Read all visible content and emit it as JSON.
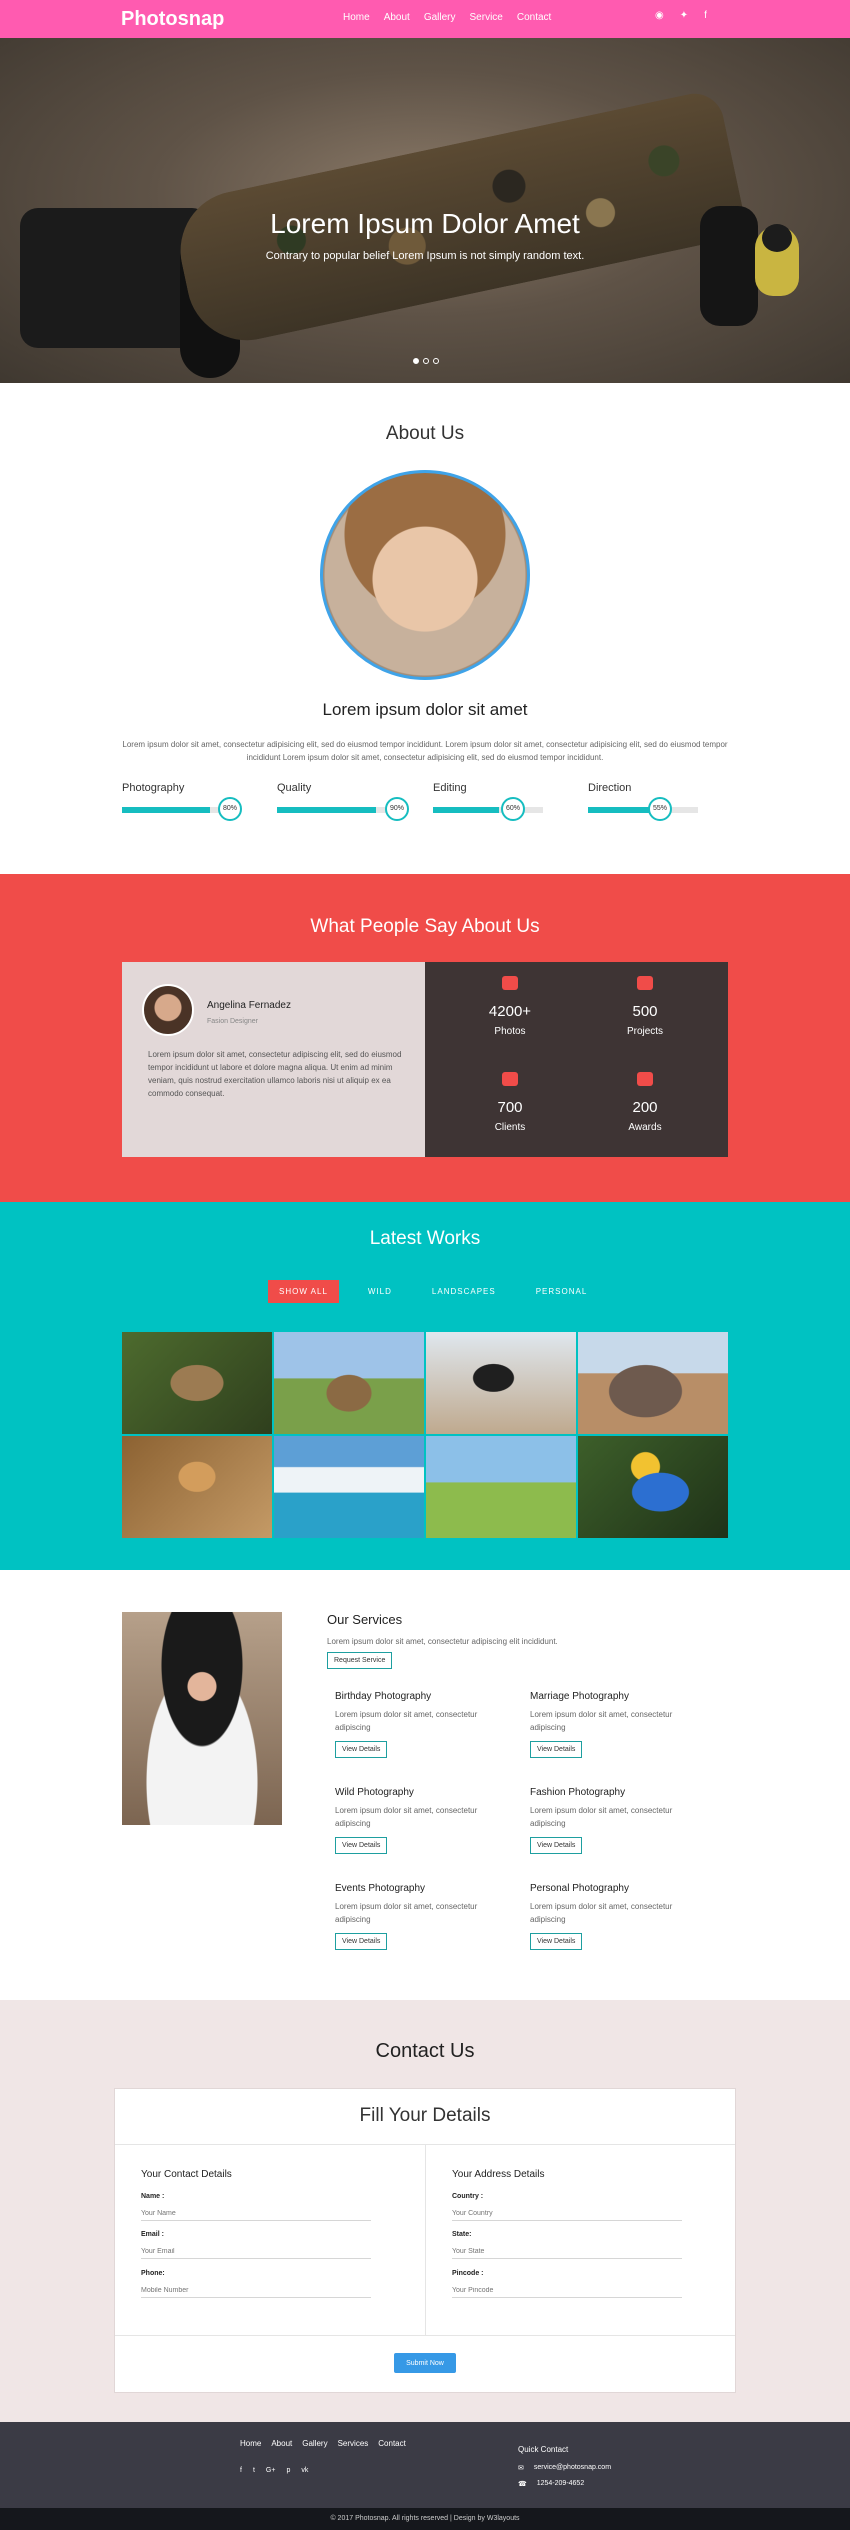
{
  "nav": {
    "brand": "Photosnap",
    "items": [
      "Home",
      "About",
      "Gallery",
      "Service",
      "Contact"
    ],
    "social_icons": [
      "rss-icon",
      "twitter-icon",
      "facebook-icon"
    ],
    "social_glyphs": [
      "ℜ",
      "🐦",
      "f"
    ]
  },
  "hero": {
    "title": "Lorem Ipsum Dolor Amet",
    "subtitle": "Contrary to popular belief Lorem Ipsum is not simply random text."
  },
  "about": {
    "title": "About Us",
    "heading": "Lorem ipsum dolor sit amet",
    "text": "Lorem ipsum dolor sit amet, consectetur adipisicing elit, sed do eiusmod tempor incididunt. Lorem ipsum dolor sit amet, consectetur adipisicing elit, sed do eiusmod tempor incididunt Lorem ipsum dolor sit amet, consectetur adipisicing elit, sed do eiusmod tempor incididunt.",
    "skills": [
      {
        "label": "Photography",
        "percent": 80,
        "display": "80%"
      },
      {
        "label": "Quality",
        "percent": 90,
        "display": "90%"
      },
      {
        "label": "Editing",
        "percent": 60,
        "display": "60%"
      },
      {
        "label": "Direction",
        "percent": 55,
        "display": "55%"
      }
    ]
  },
  "testimonial": {
    "title": "What People Say About Us",
    "name": "Angelina Fernadez",
    "role": "Fasion Designer",
    "quote": "Lorem ipsum dolor sit amet, consectetur adipiscing elit, sed do eiusmod tempor incididunt ut labore et dolore magna aliqua. Ut enim ad minim veniam, quis nostrud exercitation ullamco laboris nisi ut aliquip ex ea commodo consequat.",
    "stats": [
      {
        "value": "4200+",
        "label": "Photos",
        "icon": "camera-icon"
      },
      {
        "value": "500",
        "label": "Projects",
        "icon": "rocket-icon"
      },
      {
        "value": "700",
        "label": "Clients",
        "icon": "users-icon"
      },
      {
        "value": "200",
        "label": "Awards",
        "icon": "handshake-icon"
      }
    ]
  },
  "works": {
    "title": "Latest Works",
    "filters": [
      "SHOW ALL",
      "WILD",
      "LANDSCAPES",
      "PERSONAL"
    ],
    "active_filter": "SHOW ALL",
    "images": [
      "owl",
      "deer",
      "woman-with-camera",
      "elephants",
      "butterfly",
      "glacier",
      "countryside-road",
      "parrot"
    ]
  },
  "services": {
    "title": "Our Services",
    "desc": "Lorem ipsum dolor sit amet, consectetur adipiscing elit incididunt.",
    "request_label": "Request Service",
    "item_text": "Lorem ipsum dolor sit amet, consectetur adipiscing",
    "details_label": "View Details",
    "items": [
      "Birthday Photography",
      "Marriage Photography",
      "Wild Photography",
      "Fashion Photography",
      "Events Photography",
      "Personal Photography"
    ]
  },
  "contact": {
    "title": "Contact Us",
    "form_title": "Fill Your Details",
    "left_title": "Your Contact Details",
    "right_title": "Your Address Details",
    "fields_left": [
      {
        "label": "Name :",
        "placeholder": "Your Name"
      },
      {
        "label": "Email :",
        "placeholder": "Your Email"
      },
      {
        "label": "Phone:",
        "placeholder": "Mobile Number"
      }
    ],
    "fields_right": [
      {
        "label": "Country :",
        "placeholder": "Your Country"
      },
      {
        "label": "State:",
        "placeholder": "Your State"
      },
      {
        "label": "Pincode :",
        "placeholder": "Your Pincode"
      }
    ],
    "submit_label": "Submit Now"
  },
  "footer": {
    "menu": [
      "Home",
      "About",
      "Gallery",
      "Services",
      "Contact"
    ],
    "social": [
      "f",
      "t",
      "G+",
      "p",
      "vk"
    ],
    "quick_contact_title": "Quick Contact",
    "email": "service@photosnap.com",
    "phone": "1254-209-4652",
    "copyright": "© 2017 Photosnap. All rights reserved | Design by W3layouts"
  },
  "colors": {
    "nav": "#ff5bb0",
    "accent_teal": "#00c2c2",
    "accent_red": "#f04c49",
    "dark": "#3e3434"
  }
}
